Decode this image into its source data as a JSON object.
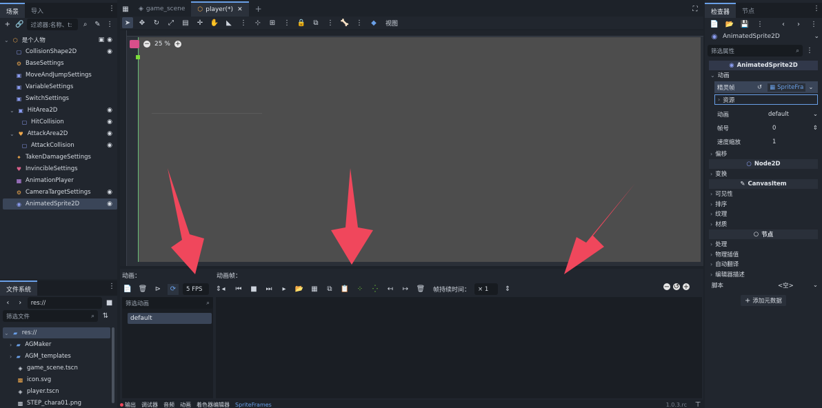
{
  "scene_panel": {
    "tabs": [
      "场景",
      "导入"
    ],
    "filter_placeholder": "过滤器:名称、t:",
    "root_node": "是个人物",
    "nodes": [
      {
        "label": "CollisionShape2D",
        "depth": 1,
        "eye": true
      },
      {
        "label": "BaseSettings",
        "depth": 1,
        "eye": false
      },
      {
        "label": "MoveAndJumpSettings",
        "depth": 1,
        "eye": false
      },
      {
        "label": "VariableSettings",
        "depth": 1,
        "eye": false
      },
      {
        "label": "SwitchSettings",
        "depth": 1,
        "eye": false
      },
      {
        "label": "HitArea2D",
        "depth": 1,
        "eye": true
      },
      {
        "label": "HitCollision",
        "depth": 2,
        "eye": true
      },
      {
        "label": "AttackArea2D",
        "depth": 1,
        "eye": true
      },
      {
        "label": "AttackCollision",
        "depth": 2,
        "eye": true
      },
      {
        "label": "TakenDamageSettings",
        "depth": 1,
        "eye": false
      },
      {
        "label": "InvincibleSettings",
        "depth": 1,
        "eye": false
      },
      {
        "label": "AnimationPlayer",
        "depth": 1,
        "eye": false
      },
      {
        "label": "CameraTargetSettings",
        "depth": 1,
        "eye": true
      },
      {
        "label": "AnimatedSprite2D",
        "depth": 1,
        "eye": true
      }
    ]
  },
  "filesystem": {
    "tab": "文件系统",
    "path": "res://",
    "filter_placeholder": "筛选文件",
    "items": [
      {
        "label": "res://",
        "depth": 0
      },
      {
        "label": "AGMaker",
        "depth": 1
      },
      {
        "label": "AGM_templates",
        "depth": 1
      },
      {
        "label": "game_scene.tscn",
        "depth": 1
      },
      {
        "label": "icon.svg",
        "depth": 1
      },
      {
        "label": "player.tscn",
        "depth": 1
      },
      {
        "label": "STEP_chara01.png",
        "depth": 1
      }
    ]
  },
  "editor": {
    "tabs": [
      "game_scene",
      "player(*)"
    ],
    "add_tab": "+",
    "view_menu": "视图",
    "zoom": "25 %"
  },
  "sprite_frames": {
    "animations_label": "动画：",
    "frames_label": "动画帧：",
    "fps": "5 FPS",
    "frame_duration_label": "帧持续时间：",
    "frame_duration_value": "× 1",
    "filter_placeholder": "筛选动画",
    "animations": [
      "default"
    ]
  },
  "bottom_bar": {
    "tabs": [
      "输出",
      "调试器",
      "音频",
      "动画",
      "着色器编辑器",
      "SpriteFrames"
    ],
    "version": "1.0.3.rc"
  },
  "inspector": {
    "tabs": [
      "检查器",
      "节点"
    ],
    "node_type": "AnimatedSprite2D",
    "filter_placeholder": "筛选属性",
    "header": "AnimatedSprite2D",
    "group_animation": "动画",
    "sprite_frames_label": "精灵帧",
    "sprite_frames_value": "SpriteFra",
    "resource_label": "资源",
    "animation_label": "动画",
    "animation_value": "default",
    "frame_label": "帧号",
    "frame_value": "0",
    "speed_label": "速度缩放",
    "speed_value": "1",
    "offset_label": "偏移",
    "node2d_header": "Node2D",
    "transform_label": "变换",
    "canvasitem_header": "CanvasItem",
    "visibility_label": "可见性",
    "ordering_label": "排序",
    "texture_label": "纹理",
    "material_label": "材质",
    "node_header": "节点",
    "process_label": "处理",
    "physics_interp_label": "物理插值",
    "auto_translate_label": "自动翻译",
    "editor_desc_label": "编辑器描述",
    "script_label": "脚本",
    "script_value": "<空>",
    "add_metadata": "添加元数据"
  },
  "colors": {
    "accent": "#6aa0e8",
    "arrow": "#f0475c",
    "viewport": "#4d4d4d",
    "selection": "#3a4558"
  }
}
